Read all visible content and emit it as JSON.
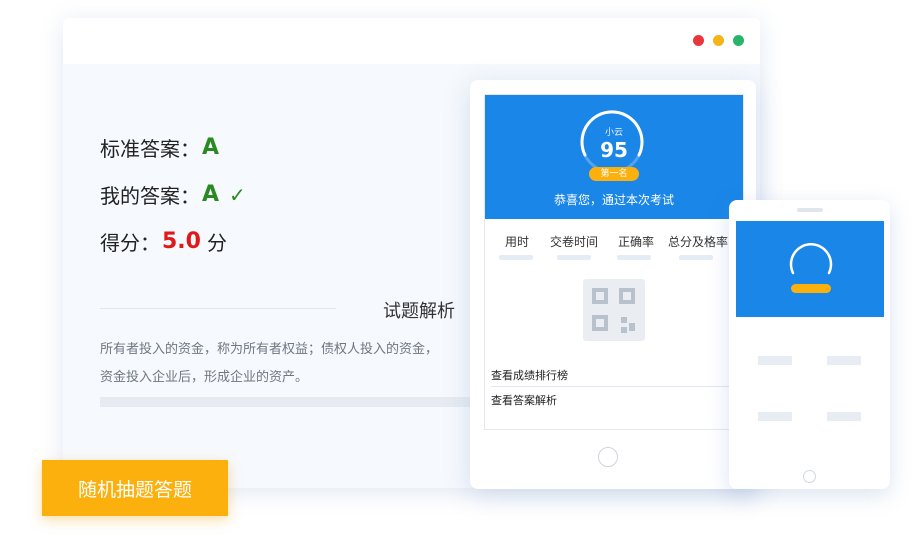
{
  "window": {
    "controls": {
      "close_color": "#e8363d",
      "minimize_color": "#f5b417",
      "maximize_color": "#28b46a"
    }
  },
  "answer": {
    "standard_label": "标准答案：",
    "standard_value": "A",
    "mine_label": "我的答案：",
    "mine_value": "A",
    "check_icon": "✓",
    "score_label": "得分：",
    "score_value": "5.0",
    "score_unit": "分"
  },
  "analysis": {
    "title": "试题解析",
    "line1": "所有者投入的资金，称为所有者权益；债权人投入的资金，",
    "line2": "资金投入企业后，形成企业的资产。"
  },
  "cta_label": "随机抽题答题",
  "tablet": {
    "user_name": "小云",
    "score": "95",
    "rank_badge": "第一名",
    "message": "恭喜您，通过本次考试",
    "stats": [
      "用时",
      "交卷时间",
      "正确率",
      "总分及格率"
    ],
    "links": [
      "查看成绩排行榜",
      "查看答案解析"
    ]
  },
  "colors": {
    "brand_blue": "#1a86e8",
    "accent_orange": "#fbb00d",
    "correct_green": "#2a8a22",
    "score_red": "#e01818"
  }
}
